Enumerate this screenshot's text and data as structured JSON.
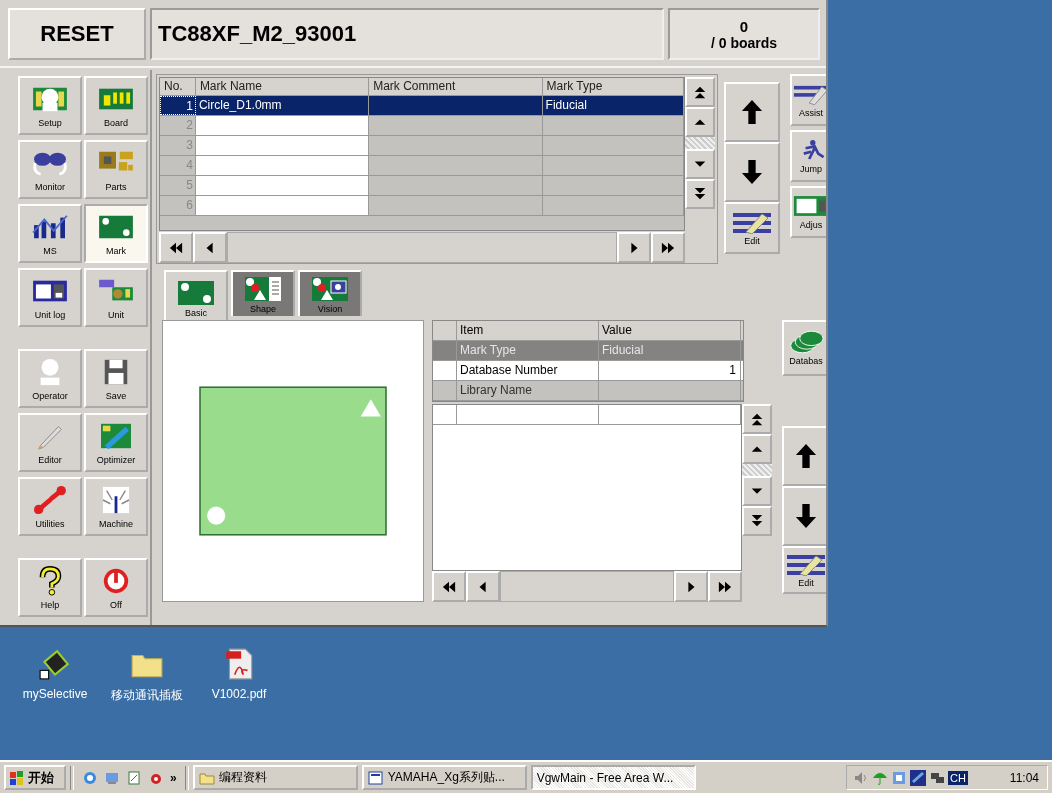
{
  "header": {
    "reset": "RESET",
    "title": "TC88XF_M2_93001",
    "count": "0",
    "boards": "/ 0 boards"
  },
  "sidebar": {
    "groups": [
      [
        {
          "label": "Setup",
          "selected": false
        },
        {
          "label": "Board",
          "selected": false
        },
        {
          "label": "Monitor",
          "selected": false
        },
        {
          "label": "Parts",
          "selected": false
        },
        {
          "label": "MS",
          "selected": false
        },
        {
          "label": "Mark",
          "selected": true
        },
        {
          "label": "Unit log",
          "selected": false
        },
        {
          "label": "Unit",
          "selected": false
        }
      ],
      [
        {
          "label": "Operator",
          "selected": false
        },
        {
          "label": "Save",
          "selected": false
        },
        {
          "label": "Editor",
          "selected": false
        },
        {
          "label": "Optimizer",
          "selected": false
        },
        {
          "label": "Utilities",
          "selected": false
        },
        {
          "label": "Machine",
          "selected": false
        }
      ],
      [
        {
          "label": "Help",
          "selected": false
        },
        {
          "label": "Off",
          "selected": false
        }
      ]
    ]
  },
  "mark_table": {
    "columns": [
      "No.",
      "Mark Name",
      "Mark Comment",
      "Mark Type"
    ],
    "rows": [
      {
        "no": "1",
        "name": "Circle_D1.0mm",
        "type": "Fiducial",
        "selected": true
      },
      {
        "no": "2",
        "selected": false
      },
      {
        "no": "3",
        "selected": false
      },
      {
        "no": "4",
        "selected": false
      },
      {
        "no": "5",
        "selected": false
      },
      {
        "no": "6",
        "selected": false
      }
    ]
  },
  "tools": [
    "Assist",
    "Jump",
    "Adjus"
  ],
  "edit_label": "Edit",
  "tabs": [
    {
      "label": "Basic",
      "selected": true
    },
    {
      "label": "Shape",
      "selected": false
    },
    {
      "label": "Vision",
      "selected": false
    }
  ],
  "properties": {
    "columns": [
      "Item",
      "Value"
    ],
    "rows": [
      {
        "item": "Mark Type",
        "value": "Fiducial",
        "kind": "locked"
      },
      {
        "item": "Database Number",
        "value": "1",
        "kind": "editable"
      },
      {
        "item": "Library Name",
        "kind": "readonly"
      }
    ]
  },
  "database_label": "Databas",
  "edit_label_lower": "Edit",
  "desktop_icons": [
    {
      "label": "mySelective"
    },
    {
      "label": "移动通讯插板"
    },
    {
      "label": "V1002.pdf"
    }
  ],
  "taskbar": {
    "start": "开始",
    "more": "»",
    "tasks": [
      {
        "label": "编程资料",
        "selected": false
      },
      {
        "label": "YAMAHA_Xg系列贴...",
        "selected": false
      },
      {
        "label": "VgwMain - Free Area W...",
        "selected": true
      }
    ],
    "language": "CH",
    "clock": "11:04"
  }
}
